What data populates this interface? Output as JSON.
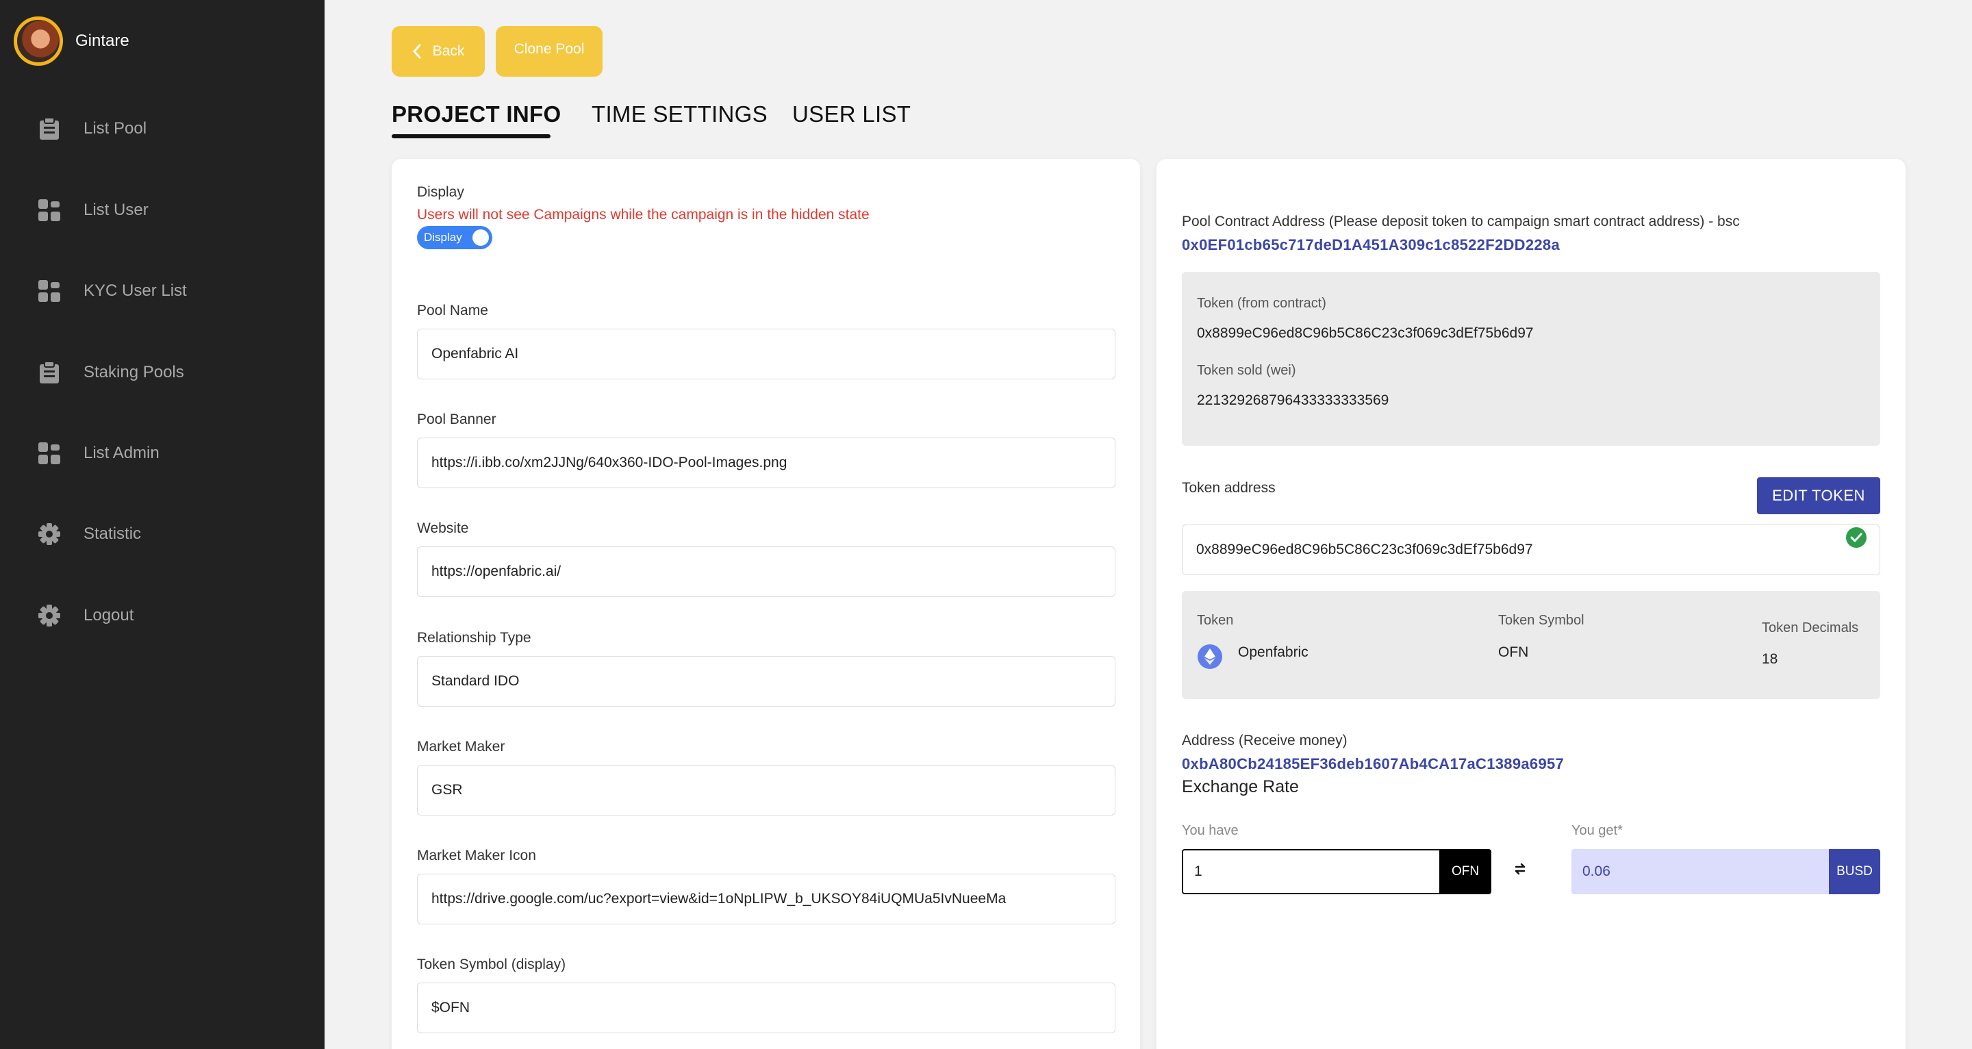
{
  "user": {
    "name": "Gintare"
  },
  "sidebar": {
    "items": [
      {
        "label": "List Pool",
        "icon": "clipboard-icon"
      },
      {
        "label": "List User",
        "icon": "grid-icon"
      },
      {
        "label": "KYC User List",
        "icon": "grid-icon"
      },
      {
        "label": "Staking Pools",
        "icon": "clipboard-icon"
      },
      {
        "label": "List Admin",
        "icon": "grid-icon"
      },
      {
        "label": "Statistic",
        "icon": "gear-icon"
      },
      {
        "label": "Logout",
        "icon": "gear-icon"
      }
    ]
  },
  "toolbar": {
    "back_label": "Back",
    "clone_label": "Clone Pool"
  },
  "tabs": [
    "PROJECT INFO",
    "TIME SETTINGS",
    "USER LIST"
  ],
  "form": {
    "display_label": "Display",
    "display_warning": "Users will not see Campaigns while the campaign is in the hidden state",
    "display_toggle": "Display",
    "fields": [
      {
        "label": "Pool Name",
        "value": "Openfabric AI"
      },
      {
        "label": "Pool Banner",
        "value": "https://i.ibb.co/xm2JJNg/640x360-IDO-Pool-Images.png"
      },
      {
        "label": "Website",
        "value": "https://openfabric.ai/"
      },
      {
        "label": "Relationship Type",
        "value": "Standard IDO"
      },
      {
        "label": "Market Maker",
        "value": "GSR"
      },
      {
        "label": "Market Maker Icon",
        "value": "https://drive.google.com/uc?export=view&id=1oNpLIPW_b_UKSOY84iUQMUa5IvNueeMa"
      },
      {
        "label": "Token Symbol (display)",
        "value": "$OFN"
      }
    ]
  },
  "contract": {
    "label": "Pool Contract Address (Please deposit token to campaign smart contract address) - bsc",
    "address": "0x0EF01cb65c717deD1A451A309c1c8522F2DD228a",
    "token_from_contract_label": "Token (from contract)",
    "token_from_contract": "0x8899eC96ed8C96b5C86C23c3f069c3dEf75b6d97",
    "token_sold_label": "Token sold (wei)",
    "token_sold": "221329268796433333333569"
  },
  "token": {
    "address_label": "Token address",
    "edit_label": "EDIT TOKEN",
    "address": "0x8899eC96ed8C96b5C86C23c3f069c3dEf75b6d97",
    "token_label": "Token",
    "token_name": "Openfabric",
    "symbol_label": "Token Symbol",
    "symbol": "OFN",
    "decimals_label": "Token Decimals",
    "decimals": "18"
  },
  "receive": {
    "label": "Address (Receive money)",
    "address": "0xbA80Cb24185EF36deb1607Ab4CA17aC1389a6957"
  },
  "exchange": {
    "title": "Exchange Rate",
    "have_label": "You have",
    "have_value": "1",
    "have_unit": "OFN",
    "get_label": "You get*",
    "get_value": "0.06",
    "get_unit": "BUSD"
  },
  "colors": {
    "accent": "#f5c842",
    "primary": "#3a45a8",
    "sidebar": "#222222",
    "warning": "#e03a2f"
  }
}
